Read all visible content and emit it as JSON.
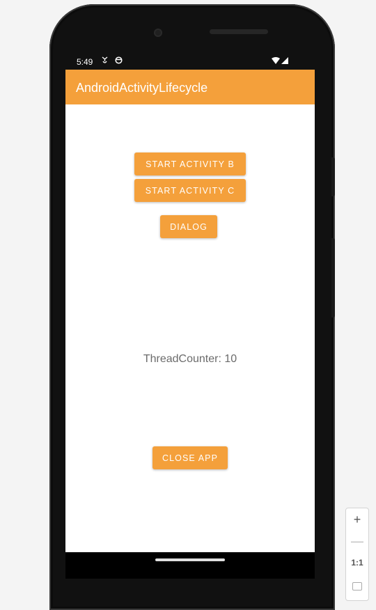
{
  "status_bar": {
    "time": "5:49",
    "icons_left": [
      "usb-debug-icon",
      "sync-icon"
    ],
    "icons_right": [
      "wifi-icon",
      "signal-icon"
    ]
  },
  "app_bar": {
    "title": "AndroidActivityLifecycle"
  },
  "content": {
    "start_activity_b": "START ACTIVITY B",
    "start_activity_c": "START ACTIVITY C",
    "dialog": "DIALOG",
    "thread_counter": "ThreadCounter: 10",
    "close_app": "CLOSE APP"
  },
  "zoom_controls": {
    "zoom_in": "+",
    "zoom_out": "—",
    "actual_size": "1:1"
  },
  "colors": {
    "accent": "#f4a03b",
    "background": "#f4f4f4",
    "screen": "#ffffff"
  }
}
